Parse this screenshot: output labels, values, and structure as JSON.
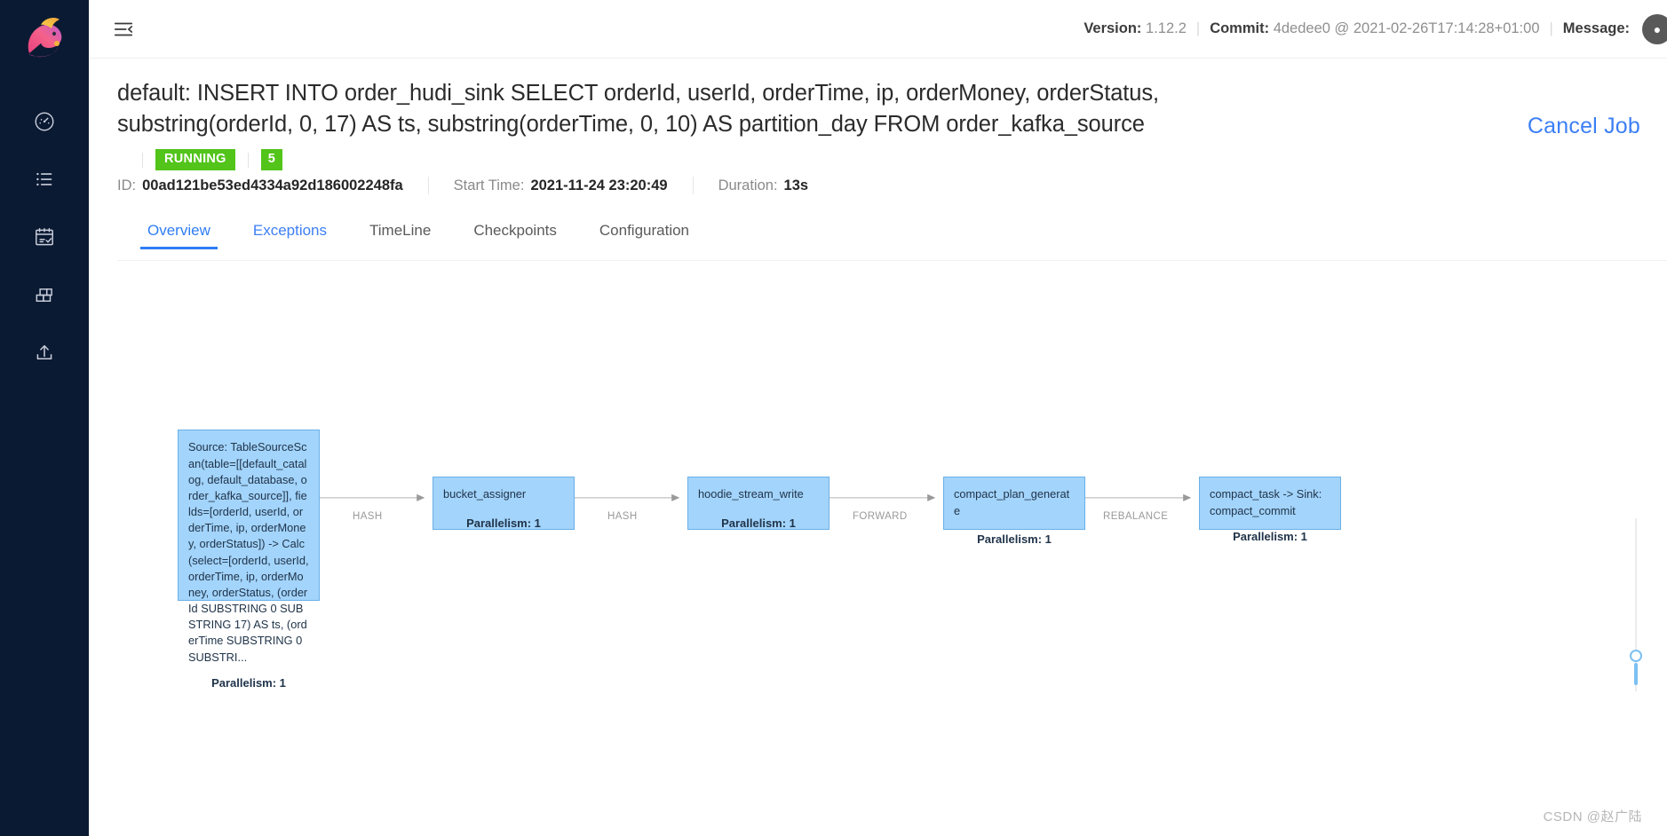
{
  "sidebar": {
    "logo_name": "flink-squirrel-logo",
    "items": [
      {
        "name": "dashboard",
        "icon": "gauge-icon"
      },
      {
        "name": "jobs",
        "icon": "list-icon"
      },
      {
        "name": "task-managers",
        "icon": "calendar-check-icon"
      },
      {
        "name": "job-manager",
        "icon": "blocks-icon"
      },
      {
        "name": "submit-new-job",
        "icon": "upload-icon"
      }
    ]
  },
  "topbar": {
    "menu_icon": "hamburger-menu-icon",
    "version_label": "Version:",
    "version_value": "1.12.2",
    "commit_label": "Commit:",
    "commit_value": "4dedee0 @ 2021-02-26T17:14:28+01:00",
    "message_label": "Message:",
    "avatar_text": "●"
  },
  "job": {
    "title": "default: INSERT INTO order_hudi_sink SELECT orderId, userId, orderTime, ip, orderMoney, orderStatus, substring(orderId, 0, 17) AS ts, substring(orderTime, 0, 10) AS partition_day FROM order_kafka_source",
    "cancel_label": "Cancel Job",
    "status": "RUNNING",
    "status_color": "#52c41a",
    "vertex_count": "5",
    "id_label": "ID:",
    "id_value": "00ad121be53ed4334a92d186002248fa",
    "start_time_label": "Start Time:",
    "start_time_value": "2021-11-24 23:20:49",
    "duration_label": "Duration:",
    "duration_value": "13s"
  },
  "tabs": [
    {
      "label": "Overview",
      "active": true,
      "link": false
    },
    {
      "label": "Exceptions",
      "active": false,
      "link": true
    },
    {
      "label": "TimeLine",
      "active": false,
      "link": false
    },
    {
      "label": "Checkpoints",
      "active": false,
      "link": false
    },
    {
      "label": "Configuration",
      "active": false,
      "link": false
    }
  ],
  "graph": {
    "node_fill": "#a3d4fb",
    "node_border": "#6ab0e8",
    "parallelism_label": "Parallelism: 1",
    "nodes": [
      {
        "id": "source",
        "title": "Source: TableSourceScan(table=[[default_catalog, default_database, order_kafka_source]], fields=[orderId, userId, orderTime, ip, orderMoney, orderStatus]) -> Calc(select=[orderId, userId, orderTime, ip, orderMoney, orderStatus, (orderId SUBSTRING 0 SUBSTRING 17) AS ts, (orderTime SUBSTRING 0 SUBSTRI...",
        "parallelism": "Parallelism: 1"
      },
      {
        "id": "bucket-assigner",
        "title": "bucket_assigner",
        "parallelism": "Parallelism: 1"
      },
      {
        "id": "hoodie-stream-write",
        "title": "hoodie_stream_write",
        "parallelism": "Parallelism: 1"
      },
      {
        "id": "compact-plan-generate",
        "title": "compact_plan_generate",
        "parallelism": "Parallelism: 1"
      },
      {
        "id": "compact-task-sink",
        "title": "compact_task -> Sink: compact_commit",
        "parallelism": "Parallelism: 1"
      }
    ],
    "edges": [
      {
        "from": "source",
        "to": "bucket-assigner",
        "label": "HASH"
      },
      {
        "from": "bucket-assigner",
        "to": "hoodie-stream-write",
        "label": "HASH"
      },
      {
        "from": "hoodie-stream-write",
        "to": "compact-plan-generate",
        "label": "FORWARD"
      },
      {
        "from": "compact-plan-generate",
        "to": "compact-task-sink",
        "label": "REBALANCE"
      }
    ]
  },
  "watermark": "CSDN @赵广陆"
}
